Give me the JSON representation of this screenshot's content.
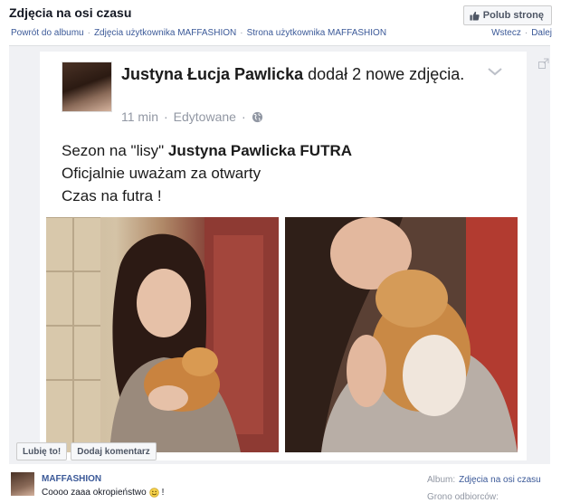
{
  "header": {
    "title": "Zdjęcia na osi czasu",
    "like_button": "Polub stronę"
  },
  "breadcrumb": {
    "back": "Powrót do albumu",
    "user_photos": "Zdjęcia użytkownika MAFFASHION",
    "user_page": "Strona użytkownika MAFFASHION"
  },
  "pager": {
    "prev": "Wstecz",
    "next": "Dalej"
  },
  "post": {
    "author": "Justyna Łucja Pawlicka",
    "action": " dodał 2 nowe zdjęcia.",
    "time": "11 min",
    "edited": "Edytowane",
    "dot": "·",
    "text_line1_prefix": "Sezon na \"lisy\" ",
    "text_line1_bold": "Justyna Pawlicka FUTRA",
    "text_line2": "Oficjalnie uważam za otwarty",
    "text_line3": "Czas na futra !"
  },
  "actions": {
    "like": "Lubię to!",
    "comment": "Dodaj komentarz"
  },
  "comment": {
    "author": "MAFFASHION",
    "text": "Coooo zaaa okropieństwo",
    "suffix": "!"
  },
  "sidebar": {
    "album_label": "Album:",
    "album_name": "Zdjęcia na osi czasu",
    "audience_label": "Grono odbiorców:"
  },
  "icons": {
    "thumb": "thumb-up-icon",
    "globe": "globe-icon",
    "chevron": "chevron-down-icon",
    "expand": "expand-icon",
    "smile": "smile-icon"
  },
  "colors": {
    "link": "#3b5998",
    "muted": "#9197a3"
  }
}
